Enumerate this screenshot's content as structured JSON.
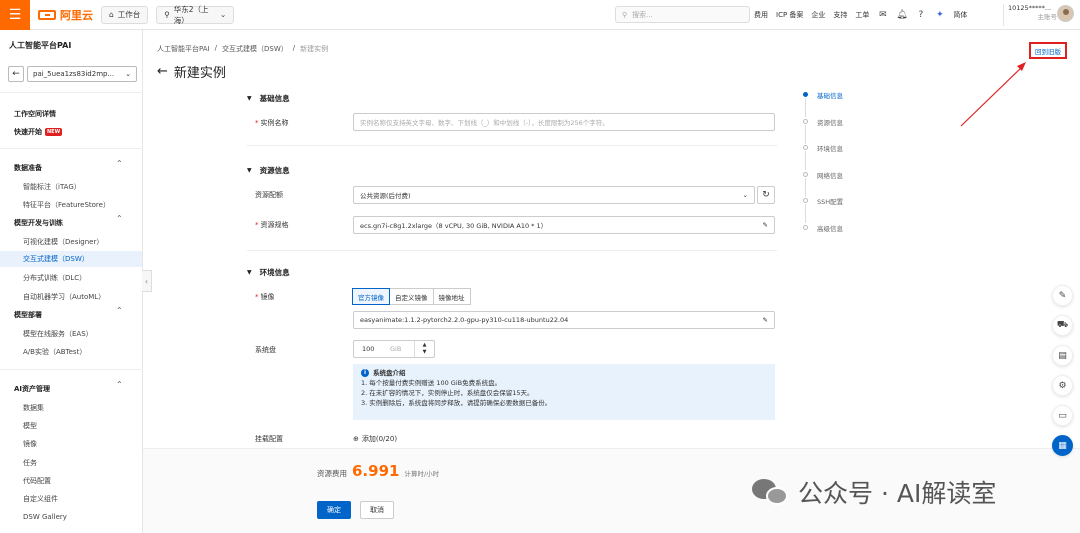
{
  "topbar": {
    "logo": "阿里云",
    "workbench": "工作台",
    "region": "华东2（上海）",
    "search_placeholder": "搜索...",
    "links": [
      "费用",
      "ICP 备案",
      "企业",
      "支持",
      "工单"
    ],
    "lang": "简体",
    "user_id": "10125*****...",
    "user_role": "主账号"
  },
  "sidebar": {
    "title": "人工智能平台PAI",
    "workspace": "pai_5uea1zs83id2mp...",
    "items": {
      "ws_detail": "工作空间详情",
      "quickstart": "快速开始",
      "new_badge": "NEW",
      "data_prep": "数据准备",
      "itag": "智能标注（iTAG）",
      "featurestore": "特征平台（FeatureStore）",
      "model_dev": "模型开发与训练",
      "designer": "可视化建模（Designer）",
      "dsw": "交互式建模（DSW）",
      "dlc": "分布式训练（DLC）",
      "automl": "自动机器学习（AutoML）",
      "deploy": "模型部署",
      "eas": "模型在线服务（EAS）",
      "abtest": "A/B实验（ABTest）",
      "ai_assets": "AI资产管理",
      "dataset": "数据集",
      "model": "模型",
      "image": "镜像",
      "task": "任务",
      "code": "代码配置",
      "custom": "自定义组件",
      "gallery": "DSW Gallery"
    }
  },
  "breadcrumb": [
    "人工智能平台PAI",
    "交互式建模（DSW）",
    "新建实例"
  ],
  "page_title": "新建实例",
  "return_link": "回到旧版",
  "sections": {
    "basic": "基础信息",
    "resource": "资源信息",
    "env": "环境信息"
  },
  "form": {
    "name_label": "实例名称",
    "name_placeholder": "实例名称仅支持英文字母、数字、下划线（_）和中划线（-），长度限制为256个字符。",
    "quota_label": "资源配额",
    "quota_value": "公共资源(后付费)",
    "spec_label": "资源规格",
    "spec_value": "ecs.gn7i-c8g1.2xlarge（8 vCPU, 30 GiB, NVIDIA A10 * 1）",
    "image_label": "镜像",
    "image_tabs": [
      "官方镜像",
      "自定义镜像",
      "镜像地址"
    ],
    "image_value": "easyanimate:1.1.2-pytorch2.2.0-gpu-py310-cu118-ubuntu22.04",
    "disk_label": "系统盘",
    "disk_value": "100",
    "disk_unit": "GiB",
    "mount_label": "挂载配置",
    "mount_add": "添加(0/20)"
  },
  "info": {
    "title": "系统盘介绍",
    "lines": [
      "1. 每个按量付费实例赠送 100 GiB免费系统盘。",
      "2. 在未扩容的情况下，实例停止时，系统盘仅会保留15天。",
      "3. 实例删除后，系统盘将同步释放，请提前确保必要数据已备份。"
    ]
  },
  "steps": [
    "基础信息",
    "资源信息",
    "环境信息",
    "网络信息",
    "SSH配置",
    "高级信息"
  ],
  "footer": {
    "cost_label": "资源费用",
    "cost_value": "6.991",
    "cost_unit": "计算时/小时",
    "confirm": "确定",
    "cancel": "取消"
  },
  "watermark": "公众号 · AI解读室"
}
